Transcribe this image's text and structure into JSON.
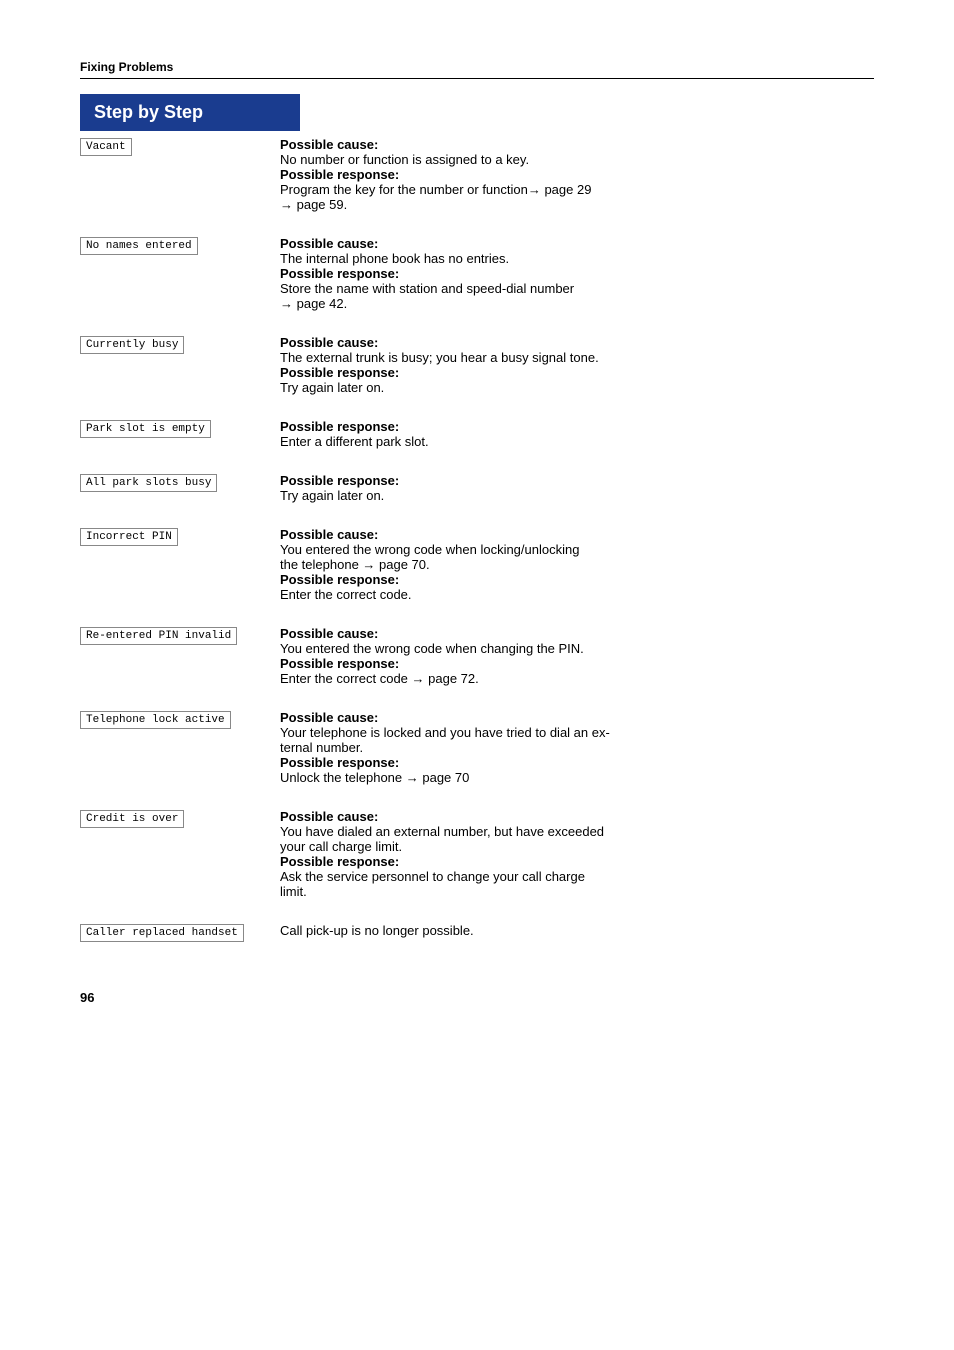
{
  "page": {
    "section_title": "Fixing Problems",
    "header": "Step by Step",
    "page_number": "96"
  },
  "rows": [
    {
      "label": "Vacant",
      "description": [
        {
          "type": "bold",
          "text": "Possible cause:"
        },
        {
          "type": "normal",
          "text": "No number or function is assigned to a key."
        },
        {
          "type": "bold",
          "text": "Possible response:"
        },
        {
          "type": "normal",
          "text": "Program the key for the number or function→ page 29"
        },
        {
          "type": "normal",
          "text": "→ page 59."
        }
      ]
    },
    {
      "label": "No names entered",
      "description": [
        {
          "type": "bold",
          "text": "Possible cause:"
        },
        {
          "type": "normal",
          "text": "The internal phone book has no entries."
        },
        {
          "type": "bold",
          "text": "Possible response:"
        },
        {
          "type": "normal",
          "text": "Store the name with station and speed-dial number"
        },
        {
          "type": "normal",
          "text": "→ page 42."
        }
      ]
    },
    {
      "label": "Currently busy",
      "description": [
        {
          "type": "bold",
          "text": "Possible cause:"
        },
        {
          "type": "normal",
          "text": "The external trunk is busy; you hear a busy signal tone."
        },
        {
          "type": "bold",
          "text": "Possible response:"
        },
        {
          "type": "normal",
          "text": "Try again later on."
        }
      ]
    },
    {
      "label": "Park slot is empty",
      "description": [
        {
          "type": "bold",
          "text": "Possible response:"
        },
        {
          "type": "normal",
          "text": "Enter a different park slot."
        }
      ]
    },
    {
      "label": "All park slots busy",
      "description": [
        {
          "type": "bold",
          "text": "Possible response:"
        },
        {
          "type": "normal",
          "text": "Try again later on."
        }
      ]
    },
    {
      "label": "Incorrect PIN",
      "description": [
        {
          "type": "bold",
          "text": "Possible cause:"
        },
        {
          "type": "normal",
          "text": "You entered the wrong code when locking/unlocking"
        },
        {
          "type": "normal",
          "text": "the telephone → page 70."
        },
        {
          "type": "bold",
          "text": "Possible response:"
        },
        {
          "type": "normal",
          "text": "Enter the correct code."
        }
      ]
    },
    {
      "label": "Re-entered PIN invalid",
      "description": [
        {
          "type": "bold",
          "text": "Possible cause:"
        },
        {
          "type": "normal",
          "text": "You entered the wrong code when changing the PIN."
        },
        {
          "type": "bold",
          "text": "Possible response:"
        },
        {
          "type": "normal",
          "text": "Enter the correct code → page 72."
        }
      ]
    },
    {
      "label": "Telephone lock active",
      "description": [
        {
          "type": "bold",
          "text": "Possible cause:"
        },
        {
          "type": "normal",
          "text": "Your telephone is locked and you have tried to dial an ex-"
        },
        {
          "type": "normal",
          "text": "ternal number."
        },
        {
          "type": "bold",
          "text": "Possible response:"
        },
        {
          "type": "normal",
          "text": "Unlock the telephone → page 70"
        }
      ]
    },
    {
      "label": "Credit is over",
      "description": [
        {
          "type": "bold",
          "text": "Possible cause:"
        },
        {
          "type": "normal",
          "text": "You have dialed an external number, but have exceeded"
        },
        {
          "type": "normal",
          "text": "your call charge limit."
        },
        {
          "type": "bold",
          "text": "Possible response:"
        },
        {
          "type": "normal",
          "text": "Ask the service personnel to change your call charge"
        },
        {
          "type": "normal",
          "text": "limit."
        }
      ]
    },
    {
      "label": "Caller replaced handset",
      "description": [
        {
          "type": "normal",
          "text": "Call pick-up is no longer possible."
        }
      ]
    }
  ]
}
